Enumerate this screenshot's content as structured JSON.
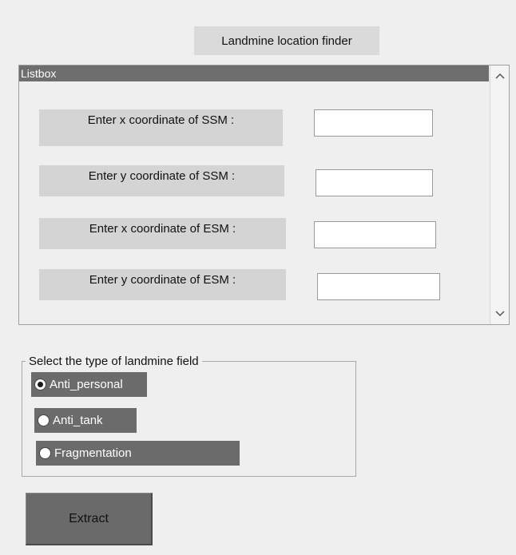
{
  "app": {
    "title": "Landmine location finder"
  },
  "listbox": {
    "header": "Listbox",
    "scroll_up_icon": "chevron-up-icon",
    "scroll_down_icon": "chevron-down-icon",
    "fields": [
      {
        "label": "Enter x coordinate of SSM :",
        "value": "",
        "placeholder": ""
      },
      {
        "label": "Enter y coordinate of SSM :",
        "value": "",
        "placeholder": ""
      },
      {
        "label": "Enter x coordinate of ESM :",
        "value": "",
        "placeholder": ""
      },
      {
        "label": "Enter y coordinate of ESM :",
        "value": "",
        "placeholder": ""
      }
    ]
  },
  "landmine_type": {
    "legend": "Select the type of landmine field",
    "options": [
      {
        "label": "Anti_personal",
        "selected": true
      },
      {
        "label": "Anti_tank",
        "selected": false
      },
      {
        "label": "Fragmentation",
        "selected": false
      }
    ]
  },
  "actions": {
    "extract_label": "Extract"
  },
  "colors": {
    "background": "#efefef",
    "label_bg": "#d4d4d4",
    "header_bg": "#6e6e6e",
    "radio_bg": "#6b6b6b",
    "button_bg": "#6a6a6a"
  }
}
